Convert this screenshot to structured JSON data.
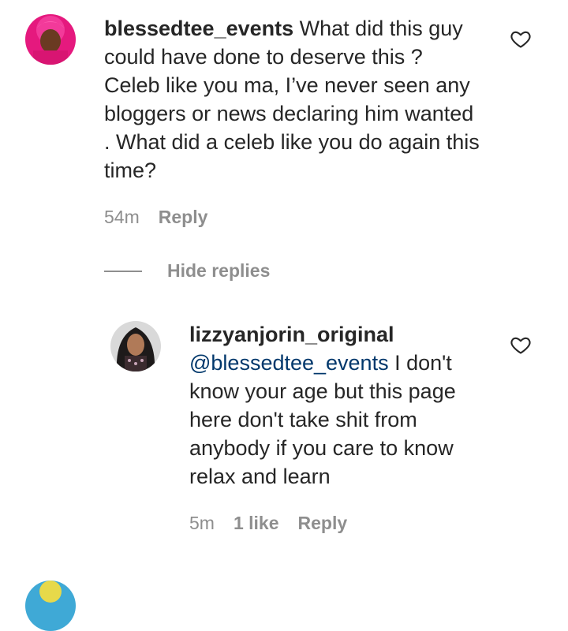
{
  "comments": [
    {
      "username": "blessedtee_events",
      "text": "What did this guy could have done to deserve this ? Celeb like you ma, I’ve never seen any bloggers or news declaring him wanted . What did a celeb like you do again this time?",
      "time": "54m",
      "reply_label": "Reply",
      "avatar_icon": "user-avatar-pink-headwrap"
    }
  ],
  "hide_replies_label": "Hide replies",
  "replies": [
    {
      "username": "lizzyanjorin_original",
      "mention": "@blessedtee_events",
      "text": "I don't know your age but this page here don't take shit from anybody if you care to know relax and learn",
      "time": "5m",
      "likes": "1 like",
      "reply_label": "Reply",
      "avatar_icon": "user-avatar-dark-hair"
    }
  ],
  "icons": {
    "like": "heart-outline-icon"
  },
  "colors": {
    "text": "#262626",
    "secondary": "#8e8e8e",
    "mention": "#00376b"
  }
}
